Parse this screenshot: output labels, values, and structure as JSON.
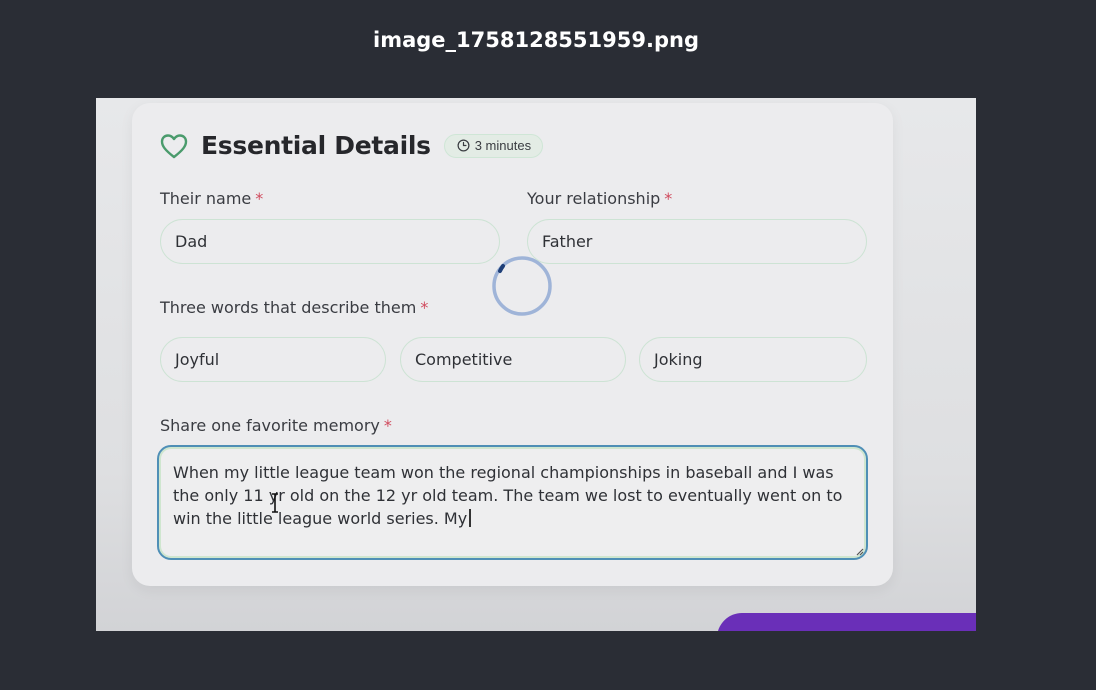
{
  "viewer": {
    "filename": "image_1758128551959.png"
  },
  "card": {
    "icon": "heart-icon",
    "title": "Essential Details",
    "badge": {
      "icon": "clock-icon",
      "text": "3 minutes"
    }
  },
  "fields": {
    "name": {
      "label": "Their name",
      "required": "*",
      "value": "Dad"
    },
    "relationship": {
      "label": "Your relationship",
      "required": "*",
      "value": "Father"
    },
    "words": {
      "label": "Three words that describe them",
      "required": "*",
      "values": [
        "Joyful",
        "Competitive",
        "Joking"
      ]
    },
    "memory": {
      "label": "Share one favorite memory",
      "required": "*",
      "value": "When my little league team won the regional championships in baseball and I was the only 11 yr old on the 12 yr old team. The team we lost to eventually went on to win the little league world series. My"
    }
  },
  "colors": {
    "accent_green": "#4a9b6c",
    "required_red": "#d04a5d",
    "focus_blue": "#4f8fb6",
    "button_purple": "#6a2fb8"
  },
  "status": {
    "loading_icon": "spinner-icon"
  }
}
